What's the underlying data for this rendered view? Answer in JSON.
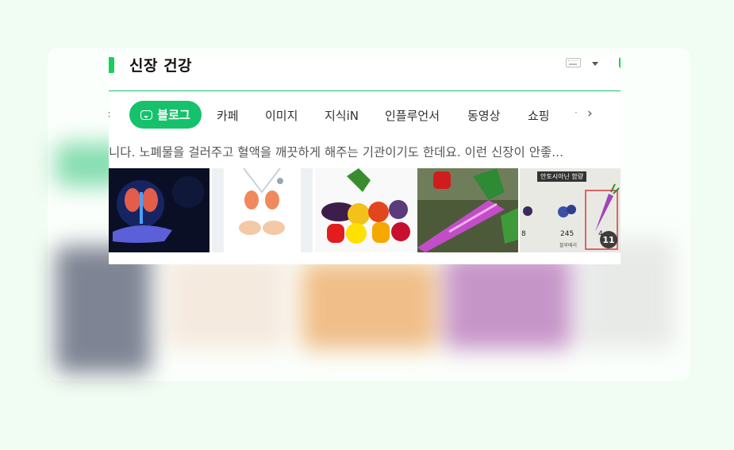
{
  "search": {
    "query": "신장 건강"
  },
  "tabs": {
    "active": "블로그",
    "items": [
      "카페",
      "이미지",
      "지식iN",
      "인플루언서",
      "동영상",
      "쇼핑"
    ],
    "more": "·"
  },
  "result": {
    "snippet": "니다. 노폐물을 걸러주고 혈액을 깨끗하게 해주는 기관이기도 한데요. 이런 신장이 안좋..."
  },
  "thumbnails": {
    "items": [
      {
        "icon": "kidney-hologram-image"
      },
      {
        "icon": "kidney-doctor-hands-image"
      },
      {
        "icon": "vegetables-fruits-image"
      },
      {
        "icon": "purple-carrot-image"
      },
      {
        "icon": "anthocyanin-chart-image"
      }
    ],
    "chart_title": "안토시아닌 함량",
    "chart_values": [
      "8",
      "245",
      "4"
    ],
    "chart_label": "블루베리",
    "count_badge": "11"
  },
  "colors": {
    "accent": "#15c26b",
    "background": "#f1fcf2"
  }
}
